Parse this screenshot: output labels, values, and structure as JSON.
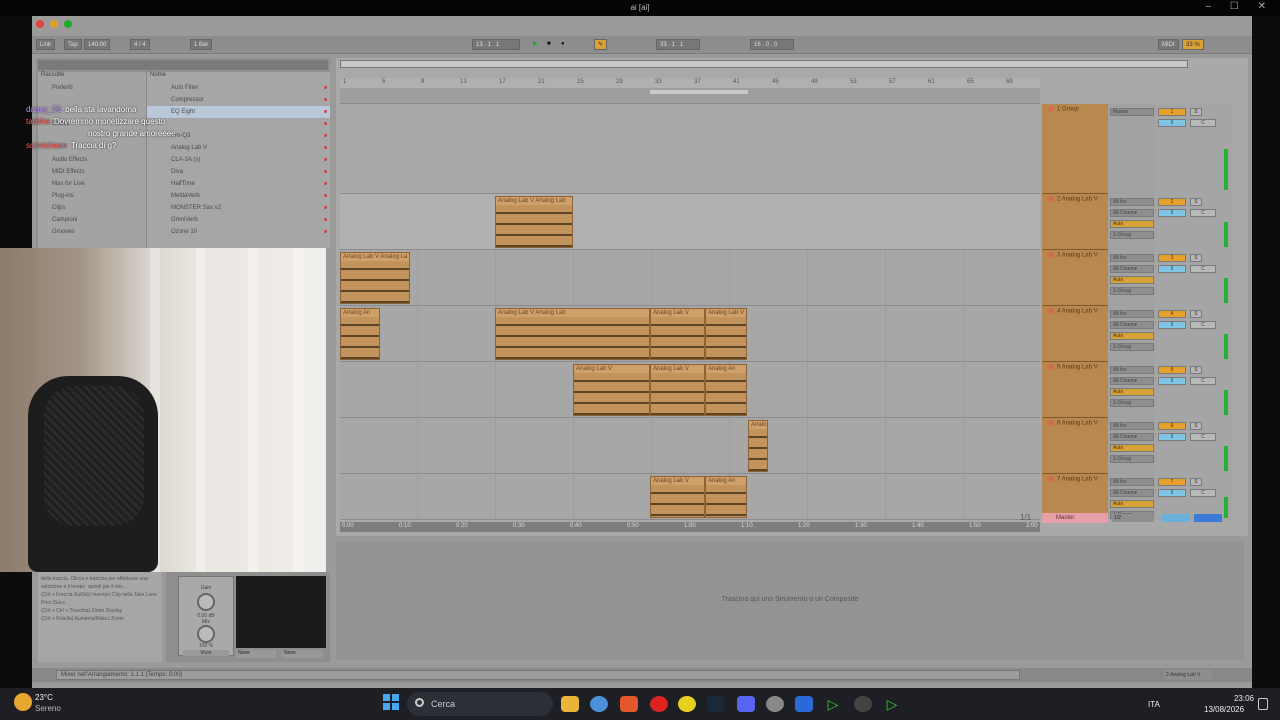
{
  "window": {
    "title": "ai [ai]",
    "controls": "– ☐ ✕"
  },
  "chat": [
    {
      "user": "danny_06",
      "message": "bella sta lavandoma",
      "badge": "purple"
    },
    {
      "user": "tabitha",
      "message": "Dovremmo monetizzare questo",
      "badge": "none"
    },
    {
      "user": "",
      "message": "nostro grande amoreeee",
      "badge": "none"
    },
    {
      "user": "scrmichaen",
      "message": "Traccia di g?",
      "badge": "gold"
    }
  ],
  "browser": {
    "categories_header": "Raccolte",
    "items_header": "Nome",
    "categories": [
      "Preferiti",
      "",
      "",
      "Drums",
      "",
      "",
      "Audio Effects",
      "MIDI Effects",
      "Max for Live",
      "Plug-ins",
      "Clips",
      "Campioni",
      "Grooves"
    ],
    "items": [
      "Auto Filter",
      "Compressor",
      "EQ Eight",
      "",
      "Pro-Q3",
      "Analog Lab V",
      "CLA-3A (s)",
      "Diva",
      "HalfTime",
      "MeldaVerb",
      "MONSTER Sax v2",
      "OmniVerb",
      "Ozone 10"
    ]
  },
  "transport": {
    "link": "Link",
    "tap": "Tap",
    "tempo": "140.00",
    "meter": "4 / 4",
    "quantize": "1 Bar",
    "position": "13 . 1 . 1",
    "loop_start": "33 . 1 . 1",
    "loop_length": "16 . 0 . 0",
    "midi": "MIDI",
    "cpu": "33 %"
  },
  "ruler": [
    "1",
    "5",
    "9",
    "13",
    "17",
    "21",
    "25",
    "29",
    "33",
    "37",
    "41",
    "45",
    "49",
    "53",
    "57",
    "61",
    "65",
    "69"
  ],
  "time_ruler": [
    "0:00",
    "0:10",
    "0:20",
    "0:30",
    "0:40",
    "0:50",
    "1:00",
    "1:10",
    "1:20",
    "1:30",
    "1:40",
    "1:50",
    "2:00"
  ],
  "tracks": [
    {
      "name": "1 Group",
      "clips": []
    },
    {
      "name": "2 Analog Lab V",
      "clips": [
        {
          "label": "Analog Lab V Analog Lab"
        }
      ]
    },
    {
      "name": "3 Analog Lab V",
      "clips": [
        {
          "label": "Analog Lab V Analog La"
        }
      ]
    },
    {
      "name": "4 Analog Lab V",
      "clips": [
        {
          "label": "Analog Lab V Analog Lab"
        },
        {
          "label": "Analog Lab V"
        },
        {
          "label": "Analog Lab V"
        },
        {
          "label": "Analog An"
        }
      ]
    },
    {
      "name": "5 Analog Lab V",
      "clips": [
        {
          "label": "Analog Lab V"
        },
        {
          "label": "Analog Lab V"
        },
        {
          "label": "Analog An"
        }
      ]
    },
    {
      "name": "6 Analog Lab V",
      "clips": [
        {
          "label": "Analo"
        }
      ]
    },
    {
      "name": "7 Analog Lab V",
      "clips": [
        {
          "label": "Analog Lab V"
        },
        {
          "label": "Analog An"
        }
      ]
    }
  ],
  "master": {
    "name": "Master",
    "page": "1/1",
    "io": "1/2"
  },
  "io": {
    "input": "All Ins",
    "channel": "All Channe",
    "auto": "Auto",
    "off": "Off",
    "route": "1-Group",
    "master_out": "Master"
  },
  "mixer": {
    "numbers": [
      "1",
      "2",
      "3",
      "4",
      "5",
      "6",
      "7"
    ],
    "solo": "S",
    "vol": "0",
    "pan": "C"
  },
  "detail_hint": "Trascina qui uno Strumento o un Composite",
  "info_text": "della traccia. Clicca e trascina per effettuare una selezione e il tempo. quindi per il mix...\n(Ctrl + Freccia Su/Giù) Inserisci Clip nella Take Lane Prec./Succ.\n(Ctrl + Ctrl + Trascina) Zoom Display\n(Ctrl + Rotella) Aumenta/Riduci Zoom",
  "device": {
    "gain_label": "Gain",
    "gain_value": "0.00 dB",
    "mix_label": "Mix",
    "mix_value": "100 %",
    "mute": "Mute",
    "none1": "None",
    "none2": "None"
  },
  "status": {
    "text": "Mixer nell'Arrangiamento: 1.1.1 (Tempo: 0:00)",
    "right": "2-Analog Lab V"
  },
  "taskbar": {
    "temperature": "23°C",
    "weather": "Sereno",
    "search": "Cerca",
    "lang": "ITA",
    "time": "23:06",
    "date": "13/08/2026"
  },
  "colors": {
    "clip": "#c2935a",
    "track_head": "#b8884f",
    "accent": "#d8a234",
    "meter": "#26b035"
  }
}
